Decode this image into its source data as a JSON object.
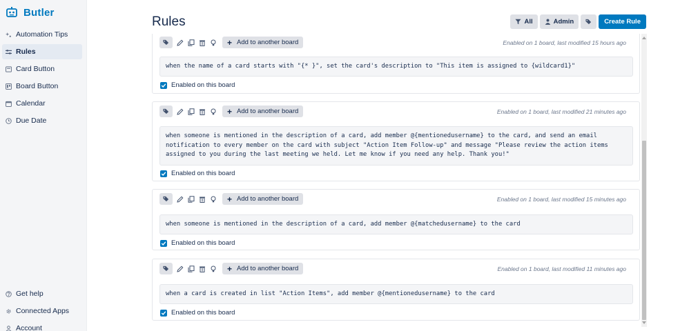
{
  "app": {
    "name": "Butler",
    "logo_icon": "butler-robot-icon",
    "brand_color": "#0079bf"
  },
  "sidebar": {
    "items": [
      {
        "label": "Automation Tips",
        "icon": "sparkle-icon"
      },
      {
        "label": "Rules",
        "icon": "rules-icon",
        "active": true
      },
      {
        "label": "Card Button",
        "icon": "card-button-icon"
      },
      {
        "label": "Board Button",
        "icon": "board-button-icon"
      },
      {
        "label": "Calendar",
        "icon": "calendar-icon"
      },
      {
        "label": "Due Date",
        "icon": "clock-icon"
      }
    ],
    "bottom_items": [
      {
        "label": "Get help",
        "icon": "help-icon"
      },
      {
        "label": "Connected Apps",
        "icon": "gear-icon"
      },
      {
        "label": "Account",
        "icon": "person-icon"
      }
    ]
  },
  "header": {
    "title": "Rules",
    "filter_label": "All",
    "admin_label": "Admin",
    "create_label": "Create Rule"
  },
  "rules": [
    {
      "add_label": "Add to another board",
      "meta": "Enabled on 1 board, last modified 15 hours ago",
      "description": "when the name of a card starts with \"{* }\", set the card's description to \"This item is assigned to {wildcard1}\"",
      "enabled_label": "Enabled on this board"
    },
    {
      "add_label": "Add to another board",
      "meta": "Enabled on 1 board, last modified 21 minutes ago",
      "description": "when someone is mentioned in the description of a card, add member @{mentionedusername} to the card, and send an email notification to every member on the card with subject \"Action Item Follow-up\" and message \"Please review the action items assigned to you during the last meeting we held. Let me know if you need any help. Thank you!\"",
      "enabled_label": "Enabled on this board"
    },
    {
      "add_label": "Add to another board",
      "meta": "Enabled on 1 board, last modified 15 minutes ago",
      "description": "when someone is mentioned in the description of a card, add member @{matchedusername} to the card",
      "enabled_label": "Enabled on this board"
    },
    {
      "add_label": "Add to another board",
      "meta": "Enabled on 1 board, last modified 11 minutes ago",
      "description": "when a card is created in list \"Action Items\", add member @{mentionedusername} to the card",
      "enabled_label": "Enabled on this board"
    }
  ]
}
